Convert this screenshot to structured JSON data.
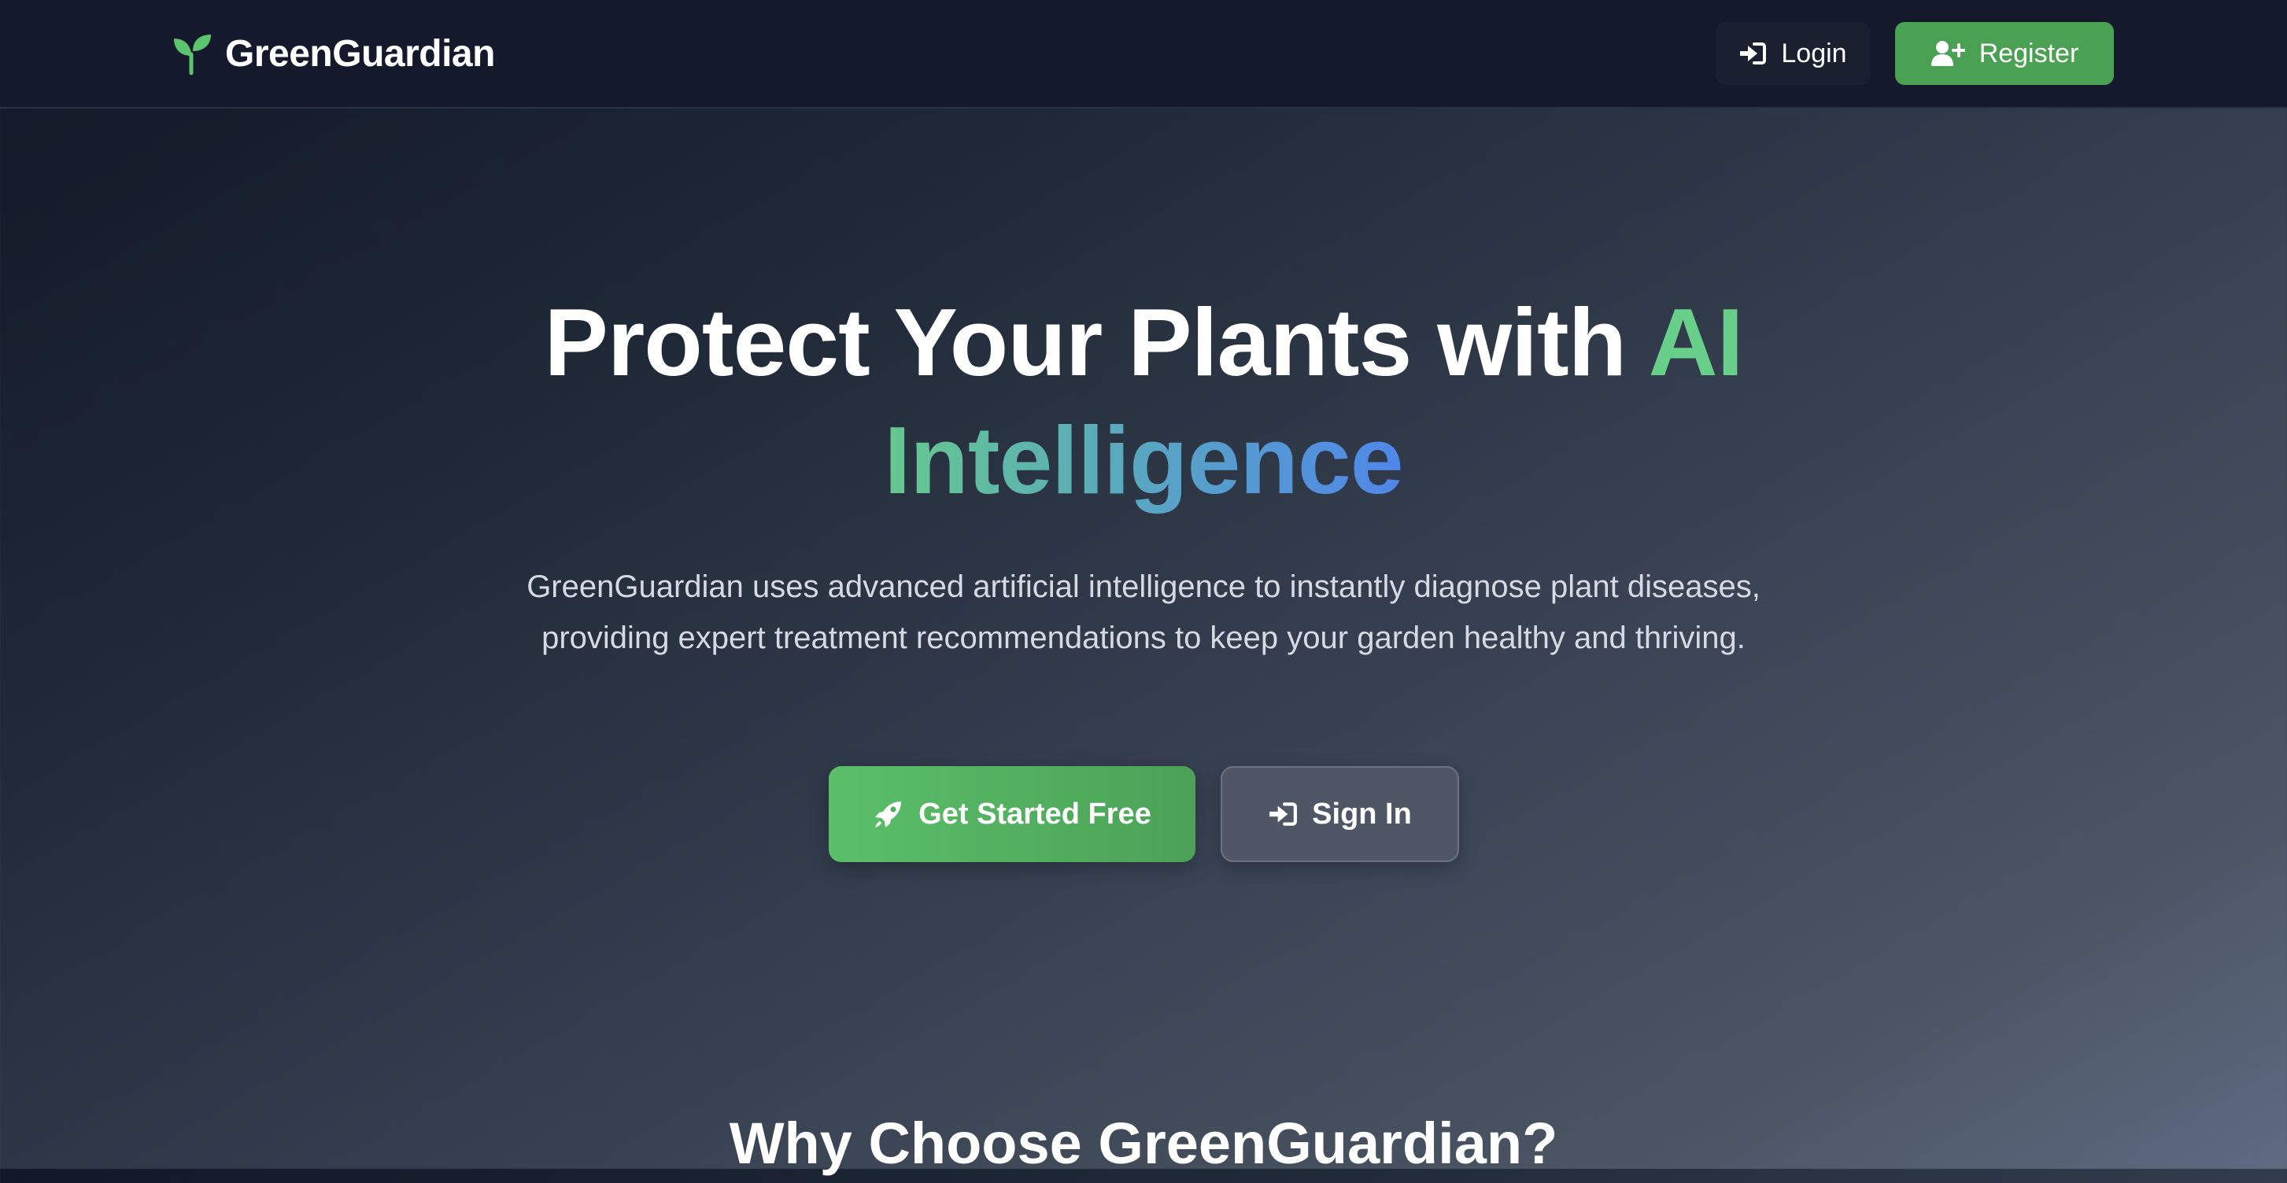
{
  "navbar": {
    "brand_name": "GreenGuardian",
    "brand_icon": "seedling-icon",
    "login_label": "Login",
    "login_icon": "sign-in-icon",
    "register_label": "Register",
    "register_icon": "user-plus-icon"
  },
  "hero": {
    "title_part1": "Protect Your Plants with ",
    "title_accent_ai": "AI",
    "title_accent_intelligence": "Intelligence",
    "description": "GreenGuardian uses advanced artificial intelligence to instantly diagnose plant diseases, providing expert treatment recommendations to keep your garden healthy and thriving.",
    "primary_cta_label": "Get Started Free",
    "primary_cta_icon": "rocket-icon",
    "secondary_cta_label": "Sign In",
    "secondary_cta_icon": "sign-in-icon"
  },
  "features": {
    "section_title": "Why Choose GreenGuardian?"
  },
  "colors": {
    "brand_green": "#4aa153",
    "accent_green": "#68cf8a",
    "accent_blue": "#4f86ea",
    "navbar_bg": "#141a2b"
  }
}
